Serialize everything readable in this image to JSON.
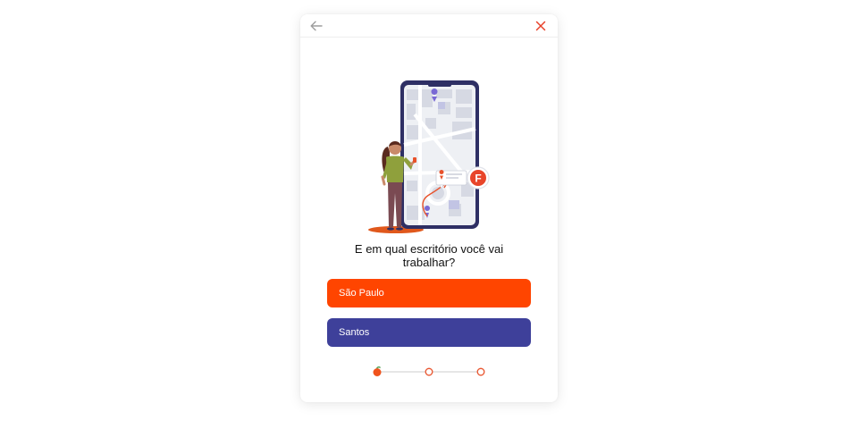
{
  "colors": {
    "primary": "#ff4500",
    "secondary": "#3e409a",
    "close": "#e8412a",
    "back": "#9e9e9e"
  },
  "header": {
    "back_icon": "arrow-left-icon",
    "close_icon": "close-icon"
  },
  "illustration": {
    "badge_letter": "F"
  },
  "question": "E em qual escritório você vai trabalhar?",
  "options": [
    {
      "label": "São Paulo"
    },
    {
      "label": "Santos"
    }
  ],
  "progress": {
    "current_step": 1,
    "total_steps": 3
  }
}
